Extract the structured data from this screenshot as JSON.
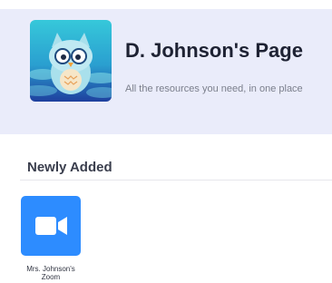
{
  "header": {
    "title": "D. Johnson's Page",
    "subtitle": "All the resources you need, in one place",
    "avatar_icon": "owl-icon"
  },
  "sections": [
    {
      "title": "Newly Added",
      "items": [
        {
          "label_line1": "Mrs. Johnson's",
          "label_line2": "Zoom",
          "icon": "zoom-video-camera-icon"
        }
      ]
    }
  ],
  "colors": {
    "banner_bg": "#eaecfa",
    "title_text": "#1e2233",
    "zoom_blue": "#2d8cff",
    "avatar_teal": "#33c4d6"
  }
}
